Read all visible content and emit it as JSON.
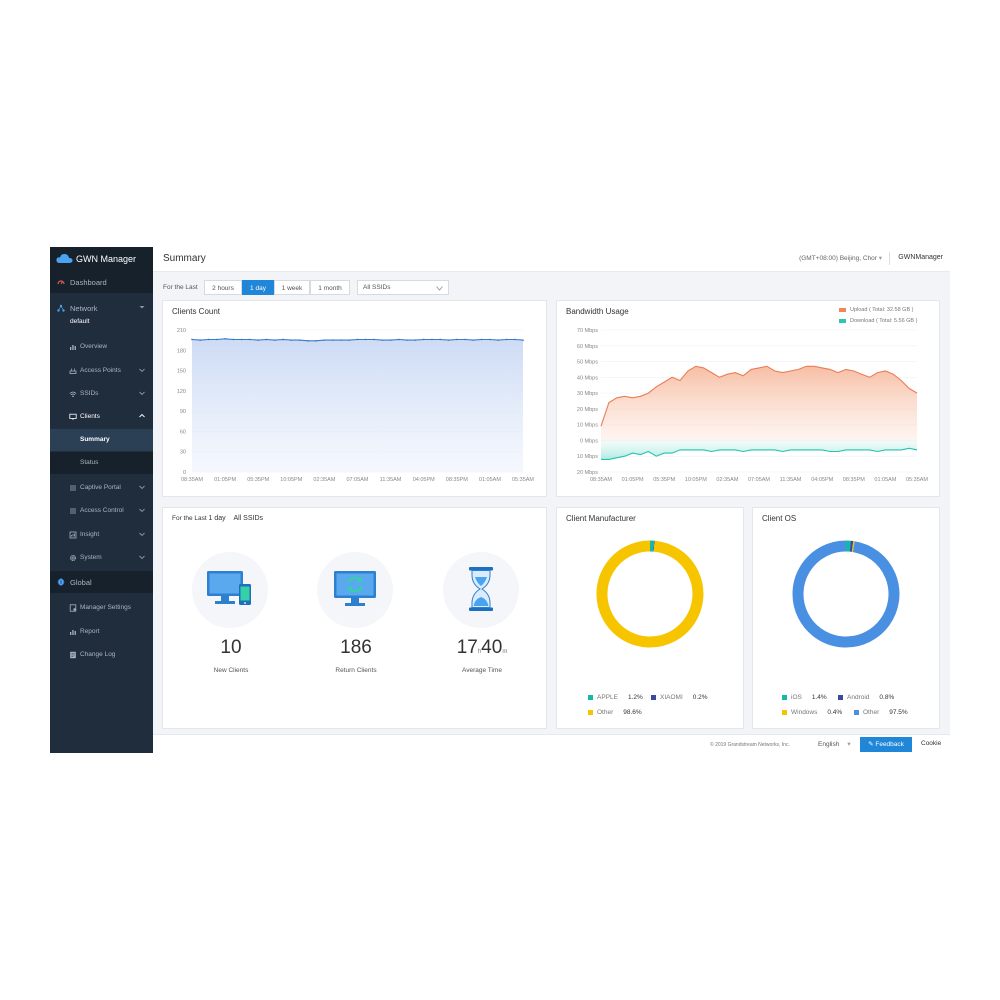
{
  "app": {
    "title": "GWN Manager"
  },
  "sidebar": {
    "dashboard": "Dashboard",
    "network": "Network",
    "network_sub": "default",
    "items": [
      {
        "label": "Overview"
      },
      {
        "label": "Access Points"
      },
      {
        "label": "SSIDs"
      },
      {
        "label": "Clients"
      },
      {
        "label": "Summary"
      },
      {
        "label": "Status"
      },
      {
        "label": "Captive Portal"
      },
      {
        "label": "Access Control"
      },
      {
        "label": "Insight"
      },
      {
        "label": "System"
      }
    ],
    "global": "Global",
    "global_items": [
      {
        "label": "Manager Settings"
      },
      {
        "label": "Report"
      },
      {
        "label": "Change Log"
      }
    ]
  },
  "header": {
    "page_title": "Summary",
    "timezone": "(GMT+08:00) Beijing, Chor",
    "user": "GWNManager"
  },
  "filter": {
    "label": "For the Last",
    "ranges": [
      "2 hours",
      "1 day",
      "1 week",
      "1 month"
    ],
    "selected": "1 day",
    "ssid": "All SSIDs"
  },
  "clients_count": {
    "title": "Clients Count",
    "chart_data": {
      "type": "area",
      "x_ticks": [
        "08:35AM",
        "01:05PM",
        "05:35PM",
        "10:05PM",
        "02:35AM",
        "07:05AM",
        "11:35AM",
        "04:05PM",
        "08:35PM",
        "01:05AM",
        "05:35AM"
      ],
      "y_ticks": [
        "210",
        "180",
        "150",
        "120",
        "90",
        "60",
        "30",
        "0"
      ],
      "ylim": [
        0,
        210
      ],
      "values": [
        196,
        195,
        196,
        196,
        197,
        196,
        196,
        196,
        195,
        196,
        195,
        196,
        195,
        195,
        194,
        194,
        195,
        195,
        195,
        195,
        196,
        196,
        196,
        195,
        195,
        196,
        195,
        195,
        196,
        196,
        196,
        195,
        196,
        196,
        195,
        196,
        196,
        195,
        196,
        196,
        195
      ],
      "color": "#3a78c8"
    }
  },
  "bandwidth": {
    "title": "Bandwidth Usage",
    "legend": [
      {
        "label": "Upload ( Total: 32.58 GB )",
        "color": "#f0875a"
      },
      {
        "label": "Download ( Total: 5.56 GB )",
        "color": "#2dc4b2"
      }
    ],
    "chart_data": {
      "type": "area",
      "x_ticks": [
        "08:35AM",
        "01:05PM",
        "05:35PM",
        "10:05PM",
        "02:35AM",
        "07:05AM",
        "11:35AM",
        "04:05PM",
        "08:35PM",
        "01:05AM",
        "05:35AM"
      ],
      "y_ticks": [
        "70 Mbps",
        "60 Mbps",
        "50 Mbps",
        "40 Mbps",
        "30 Mbps",
        "20 Mbps",
        "10 Mbps",
        "0 Mbps",
        "10 Mbps",
        "20 Mbps"
      ],
      "ylim": [
        -20,
        70
      ],
      "series": [
        {
          "name": "Upload",
          "values": [
            9,
            24,
            27,
            28,
            27,
            28,
            30,
            34,
            37,
            40,
            38,
            44,
            47,
            46,
            43,
            40,
            42,
            43,
            41,
            45,
            46,
            47,
            44,
            43,
            44,
            45,
            47,
            47,
            46,
            45,
            43,
            45,
            44,
            42,
            40,
            43,
            44,
            42,
            38,
            33,
            30
          ]
        },
        {
          "name": "Download",
          "values": [
            -12,
            -12,
            -11,
            -10,
            -8,
            -9,
            -7,
            -10,
            -8,
            -8,
            -6,
            -6,
            -6,
            -6,
            -7,
            -6,
            -6,
            -6,
            -7,
            -6,
            -6,
            -6,
            -6,
            -7,
            -6,
            -6,
            -6,
            -6,
            -6,
            -7,
            -7,
            -6,
            -6,
            -6,
            -6,
            -7,
            -6,
            -6,
            -6,
            -5,
            -6
          ]
        }
      ]
    }
  },
  "summary_card": {
    "label": "For the Last",
    "period": "1 day",
    "ssid": "All SSIDs",
    "stats": [
      {
        "value": "10",
        "caption": "New Clients"
      },
      {
        "value": "186",
        "caption": "Return Clients"
      },
      {
        "hours": "17",
        "h_unit": "h",
        "minutes": "40",
        "m_unit": "m",
        "caption": "Average Time"
      }
    ]
  },
  "manufacturer": {
    "title": "Client Manufacturer",
    "chart_data": {
      "type": "pie",
      "slices": [
        {
          "label": "APPLE",
          "value": 1.2,
          "display": "1.2%",
          "color": "#14b8a6"
        },
        {
          "label": "XIAOMI",
          "value": 0.2,
          "display": "0.2%",
          "color": "#3b4aa0"
        },
        {
          "label": "Other",
          "value": 98.6,
          "display": "98.6%",
          "color": "#f7c400"
        }
      ]
    }
  },
  "os": {
    "title": "Client OS",
    "chart_data": {
      "type": "pie",
      "slices": [
        {
          "label": "iOS",
          "value": 1.4,
          "display": "1.4%",
          "color": "#14b8a6"
        },
        {
          "label": "Android",
          "value": 0.8,
          "display": "0.8%",
          "color": "#3b4aa0"
        },
        {
          "label": "Windows",
          "value": 0.4,
          "display": "0.4%",
          "color": "#f7c400"
        },
        {
          "label": "Other",
          "value": 97.5,
          "display": "97.5%",
          "color": "#4a90e2"
        }
      ]
    }
  },
  "footer": {
    "copyright": "© 2019 Grandstream Networks, Inc.",
    "language": "English",
    "feedback": "Feedback",
    "cookie": "Cookie"
  }
}
